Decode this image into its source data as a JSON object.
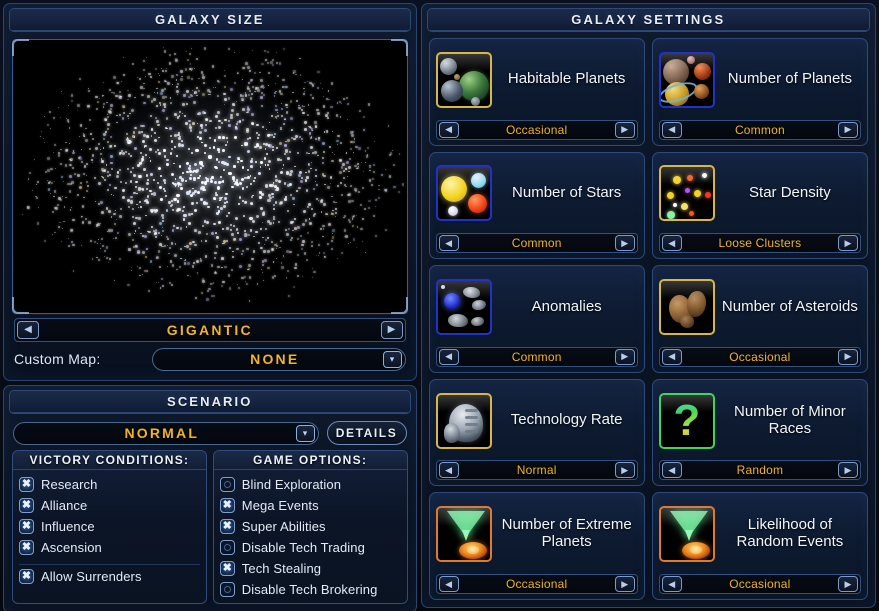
{
  "galaxy_size": {
    "panel_title": "Galaxy Size",
    "size_value": "Gigantic",
    "prev_icon": "left-arrow-icon",
    "next_icon": "right-arrow-icon",
    "custom_map_label": "Custom Map:",
    "custom_map_value": "None",
    "custom_map_chevron": "chevron-down-icon"
  },
  "scenario": {
    "panel_title": "Scenario",
    "selected": "Normal",
    "chevron": "chevron-down-icon",
    "details_label": "Details",
    "victory": {
      "title": "Victory Conditions:",
      "items": [
        {
          "label": "Research",
          "checked": true
        },
        {
          "label": "Alliance",
          "checked": true
        },
        {
          "label": "Influence",
          "checked": true
        },
        {
          "label": "Ascension",
          "checked": true
        },
        {
          "label": "Allow Surrenders",
          "checked": true,
          "separated": true
        }
      ]
    },
    "options": {
      "title": "Game Options:",
      "items": [
        {
          "label": "Blind Exploration",
          "checked": false
        },
        {
          "label": "Mega Events",
          "checked": true
        },
        {
          "label": "Super Abilities",
          "checked": true
        },
        {
          "label": "Disable Tech Trading",
          "checked": false
        },
        {
          "label": "Tech Stealing",
          "checked": true
        },
        {
          "label": "Disable Tech Brokering",
          "checked": false
        }
      ]
    }
  },
  "galaxy_settings": {
    "panel_title": "Galaxy Settings",
    "cards": [
      {
        "title": "Habitable Planets",
        "value": "Occasional",
        "icon": "habitable-planets-icon",
        "border": "#d8b64a"
      },
      {
        "title": "Number of Planets",
        "value": "Common",
        "icon": "number-of-planets-icon",
        "border": "#2032c8"
      },
      {
        "title": "Number of Stars",
        "value": "Common",
        "icon": "number-of-stars-icon",
        "border": "#2032c8"
      },
      {
        "title": "Star Density",
        "value": "Loose Clusters",
        "icon": "star-density-icon",
        "border": "#d8b64a"
      },
      {
        "title": "Anomalies",
        "value": "Common",
        "icon": "anomalies-icon",
        "border": "#2032c8"
      },
      {
        "title": "Number of Asteroids",
        "value": "Occasional",
        "icon": "asteroids-icon",
        "border": "#d8b64a"
      },
      {
        "title": "Technology Rate",
        "value": "Normal",
        "icon": "technology-rate-icon",
        "border": "#d8b64a"
      },
      {
        "title": "Number of Minor Races",
        "value": "Random",
        "icon": "minor-races-icon",
        "border": "#3fd45c"
      },
      {
        "title": "Number of Extreme Planets",
        "value": "Occasional",
        "icon": "extreme-planets-icon",
        "border": "#e07a32"
      },
      {
        "title": "Likelihood of Random Events",
        "value": "Occasional",
        "icon": "random-events-icon",
        "border": "#e07a32"
      }
    ],
    "prev_icon": "left-arrow-icon",
    "next_icon": "right-arrow-icon"
  },
  "colors": {
    "accent_gold": "#f0b42a",
    "panel_border": "#2b4570",
    "text": "#e8eef8"
  }
}
